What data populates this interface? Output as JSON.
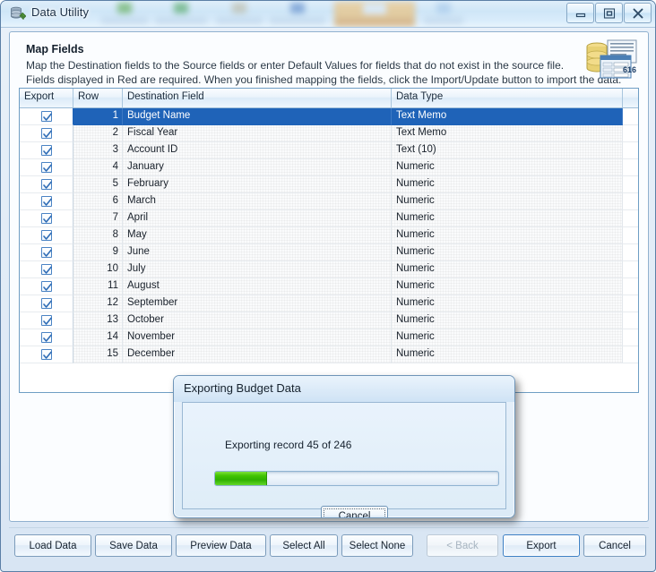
{
  "window": {
    "title": "Data Utility",
    "icon": "database-utility-icon",
    "controls": [
      {
        "name": "minimize-button",
        "glyph": "minimize"
      },
      {
        "name": "maximize-button",
        "glyph": "maximize"
      },
      {
        "name": "close-button",
        "glyph": "close"
      }
    ]
  },
  "header": {
    "title": "Map Fields",
    "line1": "Map the Destination fields to the Source fields or enter Default Values for fields that do not exist in the source file.",
    "line2": "Fields displayed in Red are required.  When you finished mapping the fields, click the Import/Update button to import the data.",
    "icon": "database-import-icon"
  },
  "grid": {
    "columns": [
      "Export",
      "Row",
      "Destination Field",
      "Data Type"
    ],
    "rows": [
      {
        "export": true,
        "row": "1",
        "field": "Budget Name",
        "type": "Text Memo",
        "selected": true
      },
      {
        "export": true,
        "row": "2",
        "field": "Fiscal Year",
        "type": "Text Memo",
        "selected": false
      },
      {
        "export": true,
        "row": "3",
        "field": "Account ID",
        "type": "Text (10)",
        "selected": false
      },
      {
        "export": true,
        "row": "4",
        "field": "January",
        "type": "Numeric",
        "selected": false
      },
      {
        "export": true,
        "row": "5",
        "field": "February",
        "type": "Numeric",
        "selected": false
      },
      {
        "export": true,
        "row": "6",
        "field": "March",
        "type": "Numeric",
        "selected": false
      },
      {
        "export": true,
        "row": "7",
        "field": "April",
        "type": "Numeric",
        "selected": false
      },
      {
        "export": true,
        "row": "8",
        "field": "May",
        "type": "Numeric",
        "selected": false
      },
      {
        "export": true,
        "row": "9",
        "field": "June",
        "type": "Numeric",
        "selected": false
      },
      {
        "export": true,
        "row": "10",
        "field": "July",
        "type": "Numeric",
        "selected": false
      },
      {
        "export": true,
        "row": "11",
        "field": "August",
        "type": "Numeric",
        "selected": false
      },
      {
        "export": true,
        "row": "12",
        "field": "September",
        "type": "Numeric",
        "selected": false
      },
      {
        "export": true,
        "row": "13",
        "field": "October",
        "type": "Numeric",
        "selected": false
      },
      {
        "export": true,
        "row": "14",
        "field": "November",
        "type": "Numeric",
        "selected": false
      },
      {
        "export": true,
        "row": "15",
        "field": "December",
        "type": "Numeric",
        "selected": false
      }
    ]
  },
  "buttons": {
    "load_data": "Load Data",
    "save_data": "Save Data",
    "preview_data": "Preview Data",
    "select_all": "Select All",
    "select_none": "Select None",
    "back": "< Back",
    "export": "Export",
    "cancel": "Cancel"
  },
  "dialog": {
    "title": "Exporting Budget Data",
    "message": "Exporting record 45 of 246",
    "current_record": 45,
    "total_records": 246,
    "progress_percent": 18,
    "cancel_label": "Cancel"
  },
  "colors": {
    "selection_blue": "#1f63b8",
    "progress_green": "#41c400",
    "title_text": "#1b2f45",
    "window_border": "#5b7fa6"
  }
}
